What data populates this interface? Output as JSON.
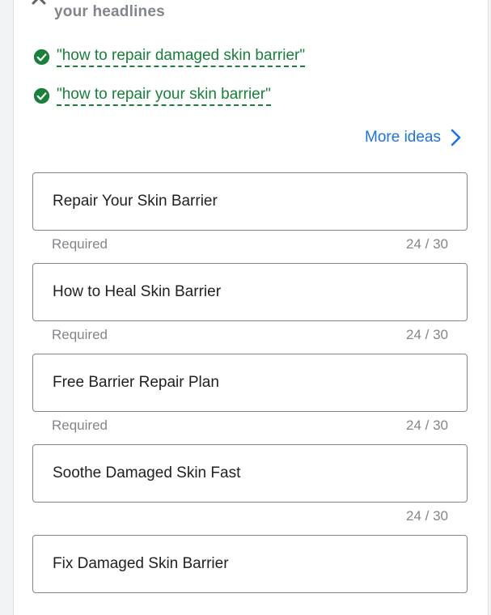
{
  "header": {
    "subtitle": "your headlines"
  },
  "suggestions": [
    {
      "text": "\"how to repair damaged skin barrier\""
    },
    {
      "text": "\"how to repair your skin barrier\""
    }
  ],
  "more_ideas_label": "More ideas",
  "headlines": [
    {
      "value": "Repair Your Skin Barrier",
      "hint": "Required",
      "counter": "24 / 30"
    },
    {
      "value": "How to Heal Skin Barrier",
      "hint": "Required",
      "counter": "24 / 30"
    },
    {
      "value": "Free Barrier Repair Plan",
      "hint": "Required",
      "counter": "24 / 30"
    },
    {
      "value": "Soothe Damaged Skin Fast",
      "hint": "",
      "counter": "24 / 30"
    },
    {
      "value": "Fix Damaged Skin Barrier",
      "hint": "",
      "counter": ""
    }
  ],
  "colors": {
    "success_green": "#188038",
    "link_blue": "#1a73e8",
    "muted_text": "#80868b",
    "field_border": "#80868b"
  },
  "icons": {
    "close": "close-icon",
    "check": "check-circle-icon",
    "chevron": "chevron-right-icon"
  }
}
